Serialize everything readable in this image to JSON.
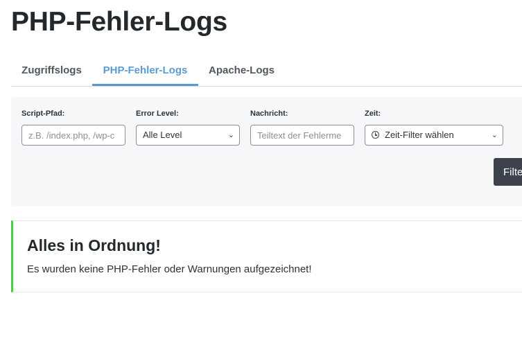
{
  "page": {
    "title": "PHP-Fehler-Logs"
  },
  "tabs": [
    {
      "label": "Zugriffslogs",
      "active": false
    },
    {
      "label": "PHP-Fehler-Logs",
      "active": true
    },
    {
      "label": "Apache-Logs",
      "active": false
    }
  ],
  "filters": {
    "script_path": {
      "label": "Script-Pfad:",
      "placeholder": "z.B. /index.php, /wp-c",
      "value": ""
    },
    "error_level": {
      "label": "Error Level:",
      "selected": "Alle Level"
    },
    "message": {
      "label": "Nachricht:",
      "placeholder": "Teiltext der Fehlerme",
      "value": ""
    },
    "time": {
      "label": "Zeit:",
      "selected": "Zeit-Filter wählen",
      "icon": "clock-icon"
    },
    "button_label": "Filte"
  },
  "notice": {
    "title": "Alles in Ordnung!",
    "text": "Es wurden keine PHP-Fehler oder Warnungen aufgezeichnet!",
    "accent_color": "#46d13d"
  },
  "colors": {
    "active_tab": "#5b9bd5",
    "button_bg": "#3c434a"
  }
}
